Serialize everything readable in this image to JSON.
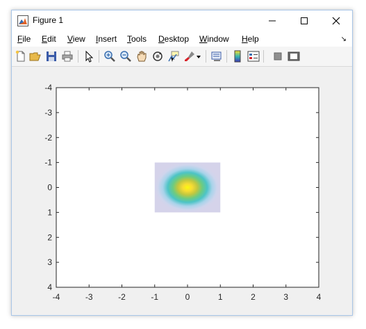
{
  "window": {
    "title": "Figure 1",
    "icon": "matlab-figure-icon",
    "controls": [
      "minimize-icon",
      "maximize-icon",
      "close-icon"
    ]
  },
  "menu": [
    {
      "label": "File",
      "underline": "F",
      "rest": "ile"
    },
    {
      "label": "Edit",
      "underline": "E",
      "rest": "dit"
    },
    {
      "label": "View",
      "underline": "V",
      "rest": "iew"
    },
    {
      "label": "Insert",
      "underline": "I",
      "rest": "nsert"
    },
    {
      "label": "Tools",
      "underline": "T",
      "rest": "ools"
    },
    {
      "label": "Desktop",
      "underline": "D",
      "rest": "esktop"
    },
    {
      "label": "Window",
      "underline": "W",
      "rest": "indow"
    },
    {
      "label": "Help",
      "underline": "H",
      "rest": "elp"
    }
  ],
  "toolbar": [
    "new-figure-icon",
    "open-file-icon",
    "save-icon",
    "print-icon",
    "edit-plot-icon",
    "zoom-in-icon",
    "zoom-out-icon",
    "pan-icon",
    "rotate-3d-icon",
    "data-cursor-icon",
    "brush-icon",
    "brush-dropdown-icon",
    "link-plot-icon",
    "insert-colorbar-icon",
    "insert-legend-icon",
    "hide-plot-tools-icon",
    "show-plot-tools-icon"
  ],
  "chart_data": {
    "type": "heatmap",
    "title": "",
    "xlabel": "",
    "ylabel": "",
    "xlim": [
      -4,
      4
    ],
    "ylim": [
      -4,
      4
    ],
    "y_direction": "reverse",
    "x_ticks": [
      "-4",
      "-3",
      "-2",
      "-1",
      "0",
      "1",
      "2",
      "3",
      "4"
    ],
    "y_ticks": [
      "-4",
      "-3",
      "-2",
      "-1",
      "0",
      "1",
      "2",
      "3",
      "4"
    ],
    "image_extent": {
      "x": [
        -1,
        1
      ],
      "y": [
        -1,
        1
      ]
    },
    "colormap": "parula",
    "peak": {
      "x": 0,
      "y": 0
    },
    "grid": false
  }
}
